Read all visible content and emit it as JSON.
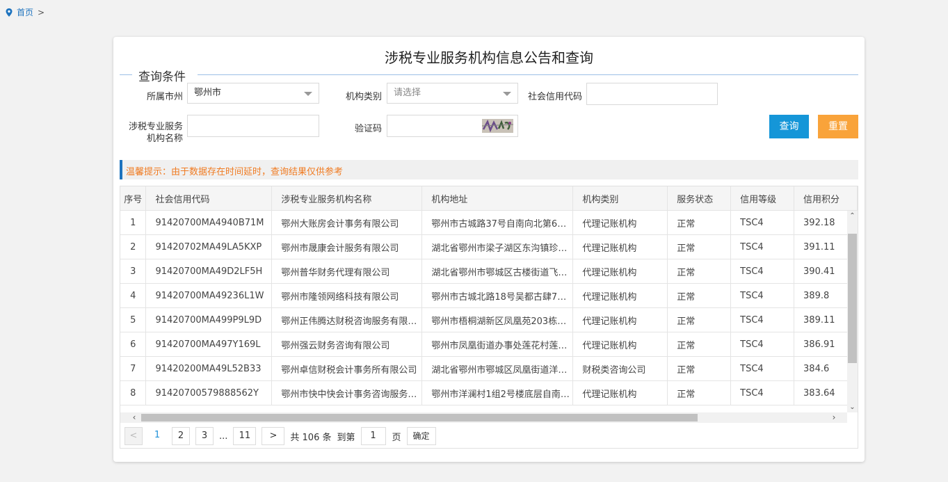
{
  "breadcrumb": {
    "home": "首页",
    "separator": ">"
  },
  "title": "涉税专业服务机构信息公告和查询",
  "conditions": {
    "legend": "查询条件",
    "city_label": "所属市州",
    "city_value": "鄂州市",
    "type_label": "机构类别",
    "type_placeholder": "请选择",
    "credit_code_label": "社会信用代码",
    "name_label_1": "涉税专业服务",
    "name_label_2": "机构名称",
    "captcha_label": "验证码"
  },
  "buttons": {
    "query": "查询",
    "reset": "重置"
  },
  "tip": "温馨提示：由于数据存在时间延时，查询结果仅供参考",
  "table": {
    "headers": [
      "序号",
      "社会信用代码",
      "涉税专业服务机构名称",
      "机构地址",
      "机构类别",
      "服务状态",
      "信用等级",
      "信用积分"
    ],
    "rows": [
      [
        "1",
        "91420700MA4940B71M",
        "鄂州大账房会计事务有限公司",
        "鄂州市古城路37号自南向北第6…",
        "代理记账机构",
        "正常",
        "TSC4",
        "392.18"
      ],
      [
        "2",
        "91420702MA49LA5KXP",
        "鄂州市晟康会计服务有限公司",
        "湖北省鄂州市梁子湖区东沟镇珍…",
        "代理记账机构",
        "正常",
        "TSC4",
        "391.11"
      ],
      [
        "3",
        "91420700MA49D2LF5H",
        "鄂州普华财务代理有限公司",
        "湖北省鄂州市鄂城区古楼街道飞…",
        "代理记账机构",
        "正常",
        "TSC4",
        "390.41"
      ],
      [
        "4",
        "91420700MA49236L1W",
        "鄂州市隆领网络科技有限公司",
        "鄂州市古城北路18号吴都古肆7…",
        "代理记账机构",
        "正常",
        "TSC4",
        "389.8"
      ],
      [
        "5",
        "91420700MA499P9L9D",
        "鄂州正伟腾达财税咨询服务有限…",
        "鄂州市梧桐湖新区凤凰苑203栋…",
        "代理记账机构",
        "正常",
        "TSC4",
        "389.11"
      ],
      [
        "6",
        "91420700MA497Y169L",
        "鄂州强云财务咨询有限公司",
        "鄂州市凤凰街道办事处莲花村莲…",
        "代理记账机构",
        "正常",
        "TSC4",
        "386.91"
      ],
      [
        "7",
        "91420200MA49L52B33",
        "鄂州卓信财税会计事务所有限公司",
        "湖北省鄂州市鄂城区凤凰街道洋…",
        "财税类咨询公司",
        "正常",
        "TSC4",
        "384.6"
      ],
      [
        "8",
        "91420700579888562Y",
        "鄂州市快中快会计事务咨询服务…",
        "鄂州市洋澜村1组2号楼底层自南…",
        "代理记账机构",
        "正常",
        "TSC4",
        "383.64"
      ]
    ]
  },
  "pagination": {
    "prev": "<",
    "pages": [
      "1",
      "2",
      "3"
    ],
    "ellipsis": "...",
    "last": "11",
    "next": ">",
    "total_text": "共 106 条",
    "goto_text": "到第",
    "goto_value": "1",
    "page_unit": "页",
    "confirm": "确定"
  }
}
